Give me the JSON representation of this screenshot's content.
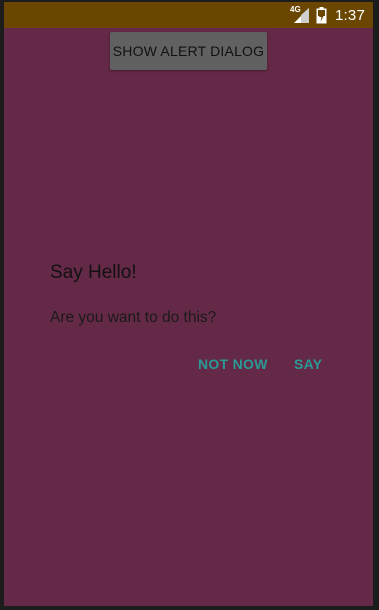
{
  "status_bar": {
    "network_label": "4G",
    "time": "1:37"
  },
  "main": {
    "show_alert_button_label": "SHOW ALERT DIALOG"
  },
  "dialog": {
    "title": "Say Hello!",
    "message": "Are you want to do this?",
    "negative_label": "NOT NOW",
    "positive_label": "SAY"
  },
  "colors": {
    "background": "#642946",
    "status_bar": "#6a4600",
    "button": "#616161",
    "dialog_action": "#2a9a94"
  },
  "icons": [
    "cellular-signal-icon",
    "battery-icon"
  ]
}
